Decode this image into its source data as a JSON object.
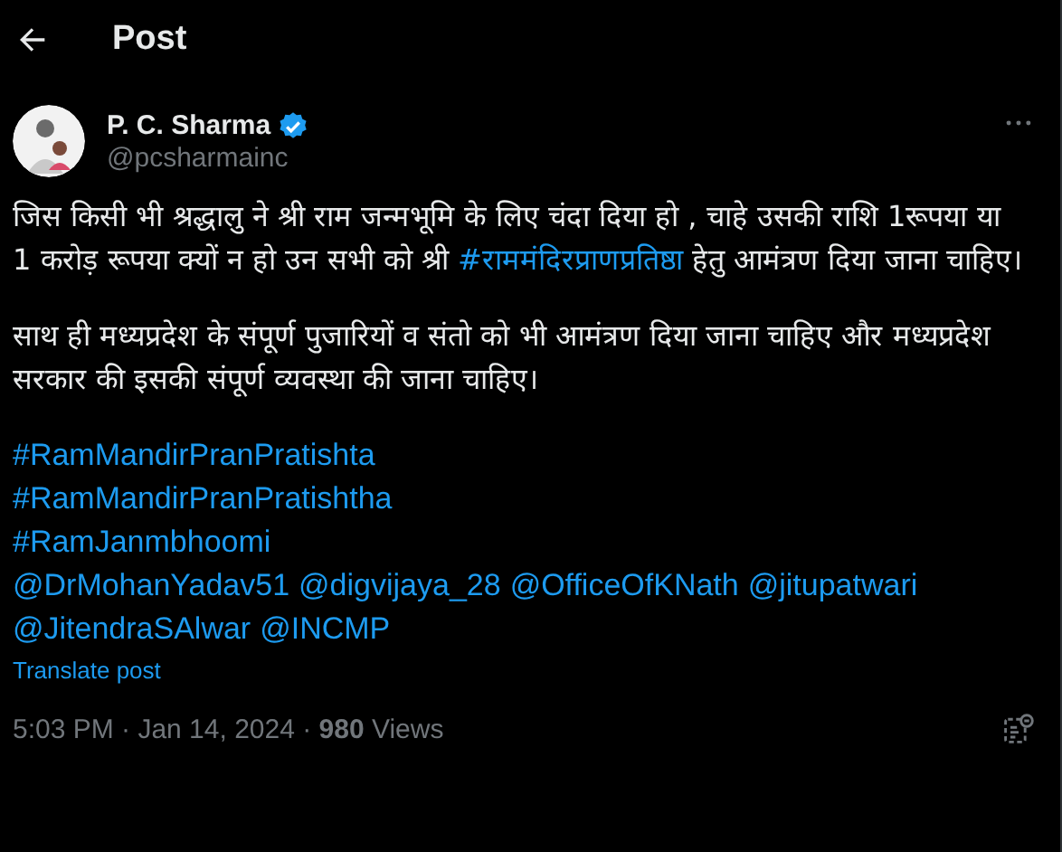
{
  "header": {
    "title": "Post"
  },
  "author": {
    "name": "P. C. Sharma",
    "verified": true,
    "handle": "@pcsharmainc"
  },
  "paragraphs": [
    [
      {
        "kind": "text",
        "text": "जिस किसी भी श्रद्धालु ने श्री राम जन्मभूमि के लिए चंदा दिया हो , चाहे उसकी राशि 1रूपया या 1 करोड़ रूपया क्यों न हो उन सभी को श्री "
      },
      {
        "kind": "link",
        "text": "#राममंदिरप्राणप्रतिष्ठा"
      },
      {
        "kind": "text",
        "text": " हेतु आमंत्रण दिया जाना चाहिए।"
      }
    ],
    [
      {
        "kind": "text",
        "text": "साथ ही मध्यप्रदेश के संपूर्ण पुजारियों व संतो को भी आमंत्रण दिया जाना चाहिए और मध्यप्रदेश सरकार की इसकी संपूर्ण व्यवस्था की जाना चाहिए।"
      }
    ]
  ],
  "link_lines": [
    [
      "#RamMandirPranPratishta"
    ],
    [
      "#RamMandirPranPratishtha"
    ],
    [
      "#RamJanmbhoomi"
    ],
    [
      "@DrMohanYadav51",
      "@digvijaya_28",
      "@OfficeOfKNath",
      "@jitupatwari"
    ],
    [
      "@JitendraSAlwar",
      "@INCMP"
    ]
  ],
  "translate": "Translate post",
  "meta": "5:03 PM · Jan 14, 2024 · **980** Views"
}
